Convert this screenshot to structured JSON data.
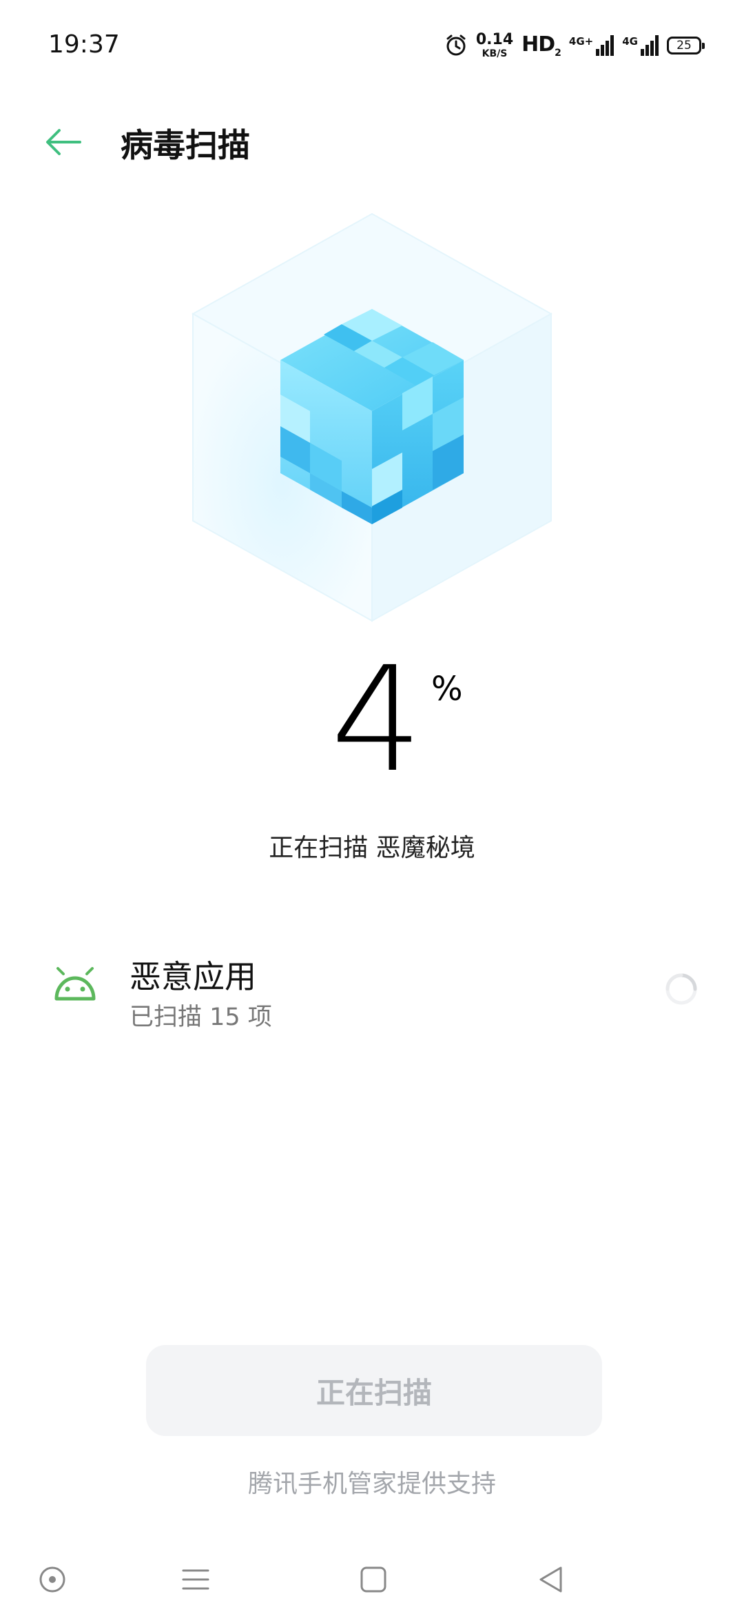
{
  "status_bar": {
    "time": "19:37",
    "speed_value": "0.14",
    "speed_unit": "KB/S",
    "hd_label": "HD",
    "hd_sub": "2",
    "network_1": "4G+",
    "network_2": "4G",
    "battery": "25",
    "icons": [
      "alarm-icon",
      "signal-icon",
      "battery-icon"
    ]
  },
  "header": {
    "title": "病毒扫描",
    "back_icon": "arrow-left-icon"
  },
  "progress": {
    "value": "4",
    "unit": "%",
    "status": "正在扫描 恶魔秘境"
  },
  "scan_item": {
    "icon": "android-icon",
    "title": "恶意应用",
    "subtitle": "已扫描 15 项"
  },
  "button": {
    "label": "正在扫描"
  },
  "footer": {
    "note": "腾讯手机管家提供支持"
  },
  "nav_bar": {
    "items": [
      "circle-nav-icon",
      "menu-nav-icon",
      "home-nav-icon",
      "back-nav-icon"
    ]
  },
  "colors": {
    "accent_green": "#3fbf7f",
    "android_green": "#5cb85c",
    "cube_blue": "#4cc8f4",
    "button_bg": "#f3f4f6",
    "button_text": "#b3b6bb"
  }
}
